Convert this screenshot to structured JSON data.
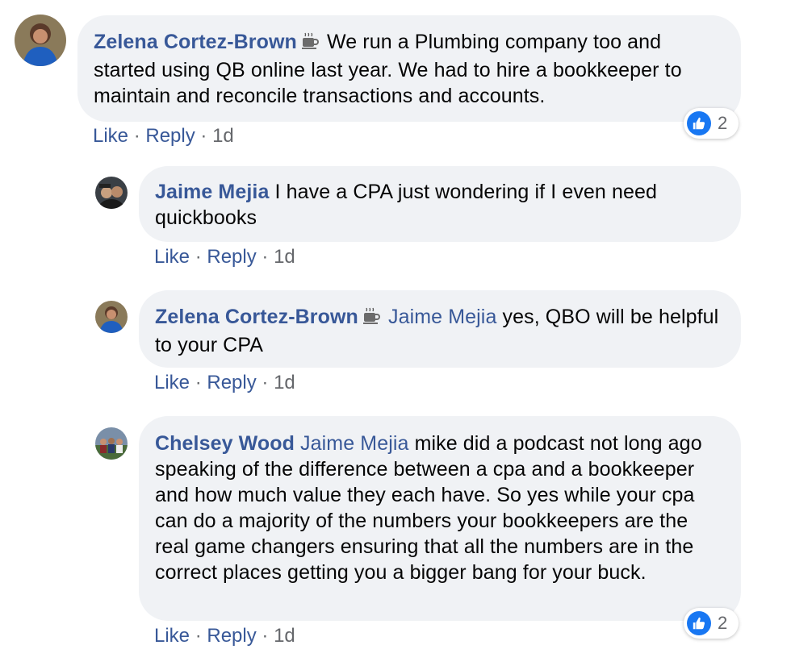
{
  "comments": [
    {
      "author": "Zelena Cortez-Brown",
      "badge_icon": "coffee-cup-icon",
      "text": "We run a Plumbing company too and started using QB online last year. We had to hire a bookkeeper to maintain and reconcile transactions and accounts.",
      "actions": {
        "like": "Like",
        "reply": "Reply",
        "time": "1d"
      },
      "reaction": {
        "icon": "like-thumb-icon",
        "count": "2"
      }
    },
    {
      "author": "Jaime Mejia",
      "text": "I have a CPA just wondering if I even need quickbooks",
      "actions": {
        "like": "Like",
        "reply": "Reply",
        "time": "1d"
      }
    },
    {
      "author": "Zelena Cortez-Brown",
      "badge_icon": "coffee-cup-icon",
      "mention": "Jaime Mejia",
      "text": "yes, QBO will be helpful to your CPA",
      "actions": {
        "like": "Like",
        "reply": "Reply",
        "time": "1d"
      }
    },
    {
      "author": "Chelsey Wood",
      "mention": "Jaime Mejia",
      "text": "mike did a podcast not long ago speaking of the difference between a cpa and a bookkeeper and how much value they each have. So yes while your cpa can do a majority of the numbers your bookkeepers are the real game changers ensuring that all the numbers are in the correct places getting you a bigger bang for your buck.",
      "actions": {
        "like": "Like",
        "reply": "Reply",
        "time": "1d"
      },
      "reaction": {
        "icon": "like-thumb-icon",
        "count": "2"
      }
    }
  ],
  "separator": "·",
  "colors": {
    "link": "#385898",
    "bubble": "#f0f2f5",
    "muted": "#65676b",
    "like_blue": "#1877f2"
  }
}
